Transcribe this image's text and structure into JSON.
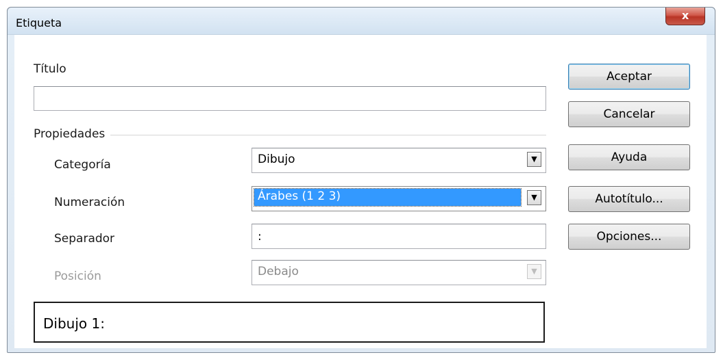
{
  "dialog": {
    "title": "Etiqueta",
    "close_label": "x"
  },
  "titulo": {
    "label": "Título",
    "value": ""
  },
  "propiedades": {
    "group_label": "Propiedades",
    "categoria": {
      "label": "Categoría",
      "value": "Dibujo"
    },
    "numeracion": {
      "label": "Numeración",
      "value": "Árabes (1 2 3)"
    },
    "separador": {
      "label": "Separador",
      "value": ":"
    },
    "posicion": {
      "label": "Posición",
      "value": "Debajo",
      "disabled": true
    }
  },
  "preview": {
    "text": "Dibujo 1:"
  },
  "buttons": {
    "aceptar": "Aceptar",
    "cancelar": "Cancelar",
    "ayuda": "Ayuda",
    "autotitulo": "Autotítulo...",
    "opciones": "Opciones..."
  },
  "icons": {
    "close": "close-icon",
    "dropdown": "chevron-down-icon"
  },
  "colors": {
    "selection": "#3399ff",
    "close_button": "#c8473a",
    "default_button_border": "#3c7fb1"
  }
}
